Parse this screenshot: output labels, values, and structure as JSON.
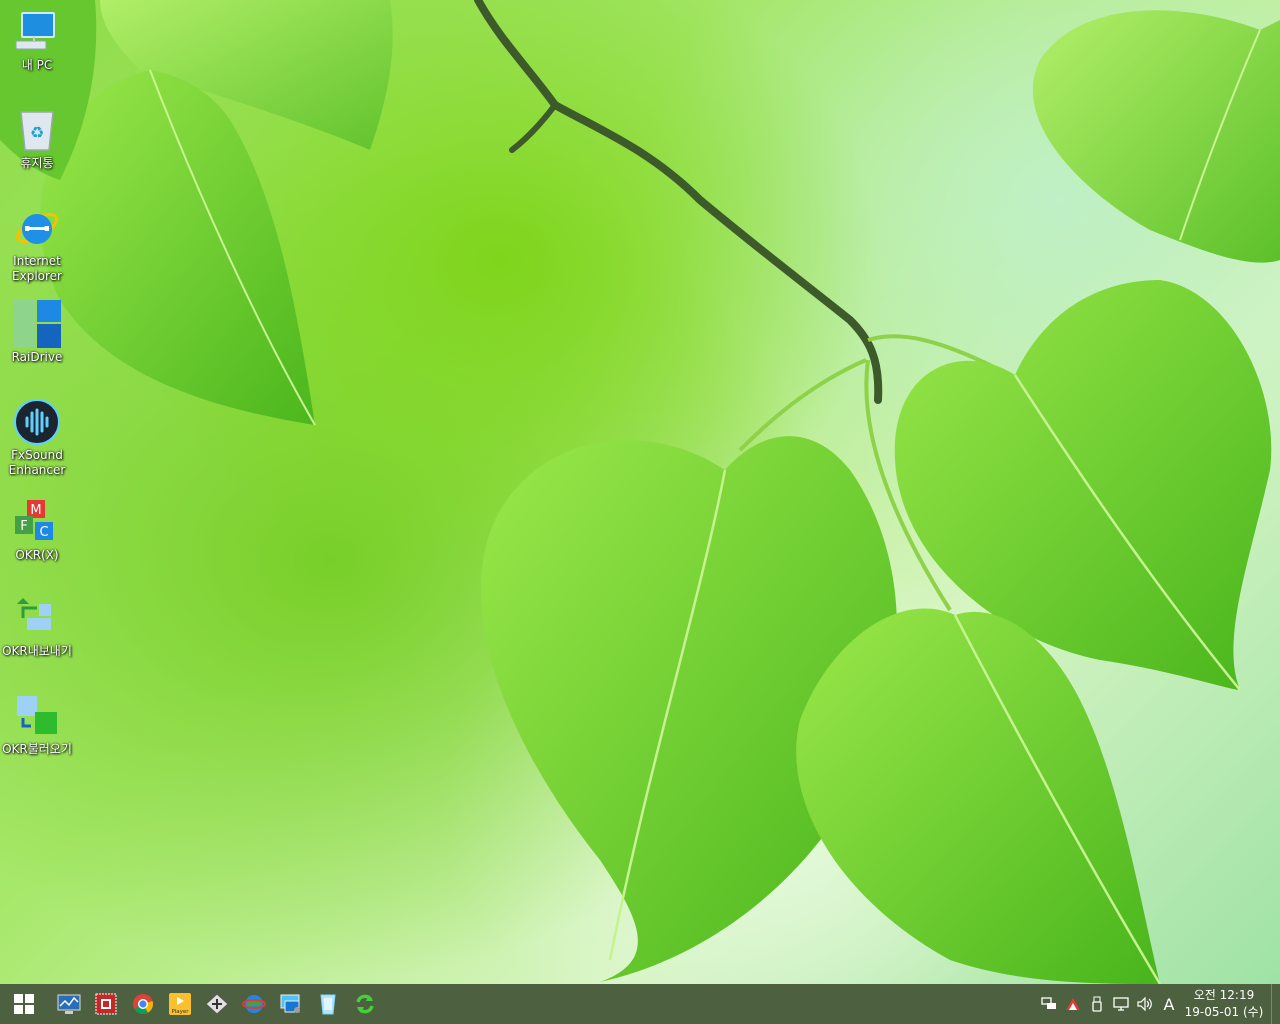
{
  "desktop": {
    "icons": [
      {
        "label": "내 PC",
        "icon": "this-pc-icon"
      },
      {
        "label": "휴지통",
        "icon": "recycle-bin-icon"
      },
      {
        "label": "Internet\nExplorer",
        "icon": "internet-explorer-icon"
      },
      {
        "label": "RaiDrive",
        "icon": "raidrive-icon"
      },
      {
        "label": "FxSound\nEnhancer",
        "icon": "fxsound-icon"
      },
      {
        "label": "OKR(X)",
        "icon": "okr-icon"
      },
      {
        "label": "OKR내보내기",
        "icon": "okr-export-icon"
      },
      {
        "label": "OKR불러오기",
        "icon": "okr-import-icon"
      }
    ]
  },
  "taskbar": {
    "start": "windows-start-icon",
    "pinned": [
      "system-monitor-icon",
      "red-app-icon",
      "chrome-icon",
      "potplayer-icon",
      "tool-icon",
      "network-globe-icon",
      "computer-management-icon",
      "cleaner-icon",
      "refresh-icon"
    ],
    "potplayer_label": "Player",
    "tray": {
      "ime": "A",
      "clock_time": "오전 12:19",
      "clock_date": "19-05-01 (수)"
    }
  }
}
